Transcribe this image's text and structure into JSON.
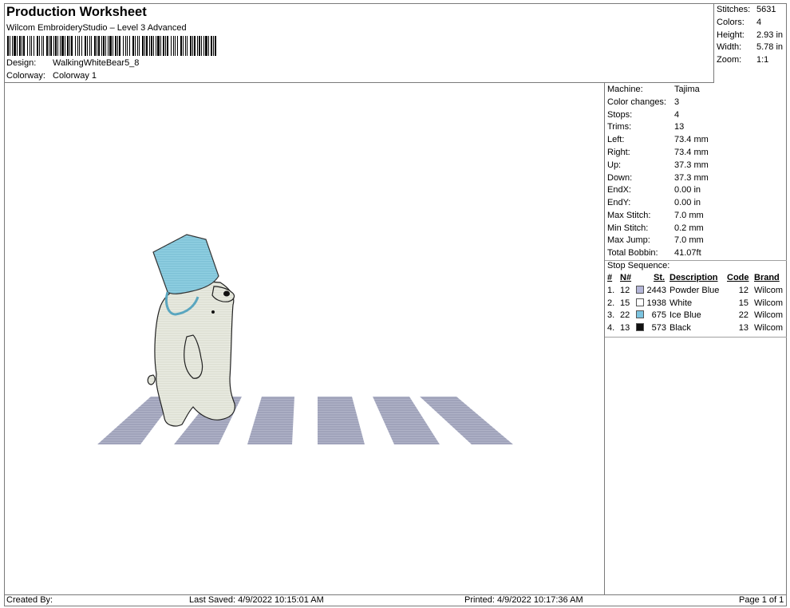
{
  "header": {
    "title": "Production Worksheet",
    "subtitle": "Wilcom EmbroideryStudio – Level 3 Advanced",
    "design_label": "Design:",
    "design_value": "WalkingWhiteBear5_8",
    "colorway_label": "Colorway:",
    "colorway_value": "Colorway 1"
  },
  "summary": {
    "stitches_label": "Stitches:",
    "stitches_value": "5631",
    "colors_label": "Colors:",
    "colors_value": "4",
    "height_label": "Height:",
    "height_value": "2.93 in",
    "width_label": "Width:",
    "width_value": "5.78 in",
    "zoom_label": "Zoom:",
    "zoom_value": "1:1"
  },
  "machine_info": {
    "machine_label": "Machine:",
    "machine_value": "Tajima",
    "color_changes_label": "Color changes:",
    "color_changes_value": "3",
    "stops_label": "Stops:",
    "stops_value": "4",
    "trims_label": "Trims:",
    "trims_value": "13",
    "left_label": "Left:",
    "left_value": "73.4 mm",
    "right_label": "Right:",
    "right_value": "73.4 mm",
    "up_label": "Up:",
    "up_value": "37.3 mm",
    "down_label": "Down:",
    "down_value": "37.3 mm",
    "endx_label": "EndX:",
    "endx_value": "0.00 in",
    "endy_label": "EndY:",
    "endy_value": "0.00 in",
    "max_stitch_label": "Max Stitch:",
    "max_stitch_value": "7.0 mm",
    "min_stitch_label": "Min Stitch:",
    "min_stitch_value": "0.2 mm",
    "max_jump_label": "Max Jump:",
    "max_jump_value": "7.0 mm",
    "total_bobbin_label": "Total Bobbin:",
    "total_bobbin_value": "41.07ft"
  },
  "stop_sequence": {
    "title": "Stop Sequence:",
    "headers": {
      "index": "#",
      "needle": "N#",
      "stitches": "St.",
      "description": "Description",
      "code": "Code",
      "brand": "Brand"
    },
    "rows": [
      {
        "index": "1.",
        "needle": "12",
        "stitches": "2443",
        "description": "Powder Blue",
        "code": "12",
        "brand": "Wilcom",
        "color": "#b4b6d8"
      },
      {
        "index": "2.",
        "needle": "15",
        "stitches": "1938",
        "description": "White",
        "code": "15",
        "brand": "Wilcom",
        "color": "#ffffff"
      },
      {
        "index": "3.",
        "needle": "22",
        "stitches": "675",
        "description": "Ice Blue",
        "code": "22",
        "brand": "Wilcom",
        "color": "#7cc4e0"
      },
      {
        "index": "4.",
        "needle": "13",
        "stitches": "573",
        "description": "Black",
        "code": "13",
        "brand": "Wilcom",
        "color": "#111111"
      }
    ]
  },
  "footer": {
    "created_by": "Created By:",
    "last_saved": "Last Saved: 4/9/2022 10:15:01 AM",
    "printed": "Printed: 4/9/2022 10:17:36 AM",
    "page": "Page 1 of 1"
  },
  "colors": {
    "border": "#7a7a7a",
    "stripe": "#a9acc2",
    "bear_body": "#e6e8dc",
    "bucket": "#86c8dc"
  }
}
